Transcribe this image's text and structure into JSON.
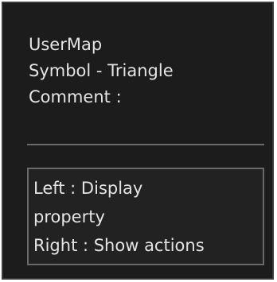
{
  "info": {
    "layer": "UserMap",
    "symbol": "Symbol - Triangle",
    "comment": "Comment :"
  },
  "hint": {
    "line1": "Left : Display",
    "line2": "property",
    "line3": "Right : Show actions"
  }
}
